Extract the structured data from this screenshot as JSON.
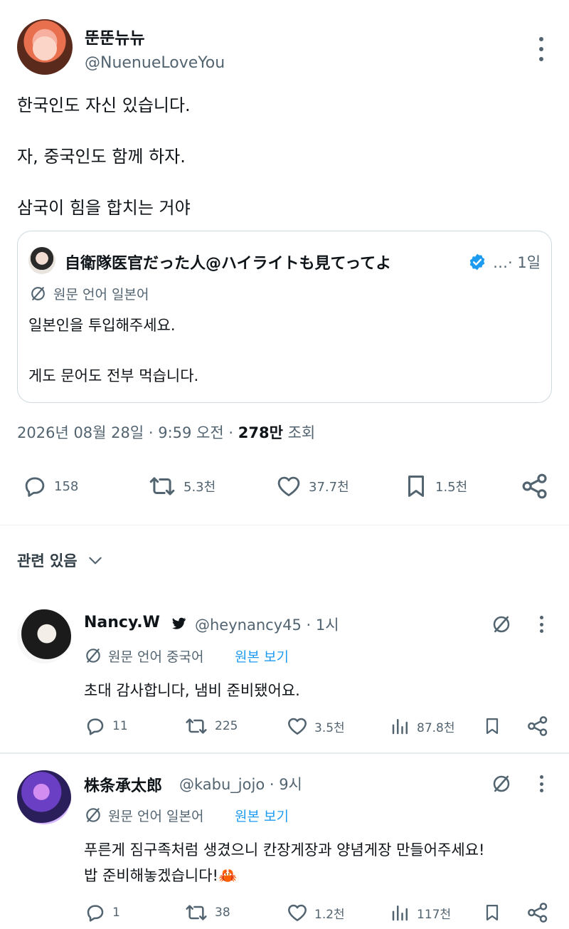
{
  "main_tweet": {
    "author_name": "뚠뚠뉴뉴",
    "handle": "@NuenueLoveYou",
    "lines": [
      "한국인도 자신 있습니다.",
      "자, 중국인도 함께 하자.",
      "삼국이 힘을 합치는 거야"
    ],
    "quote": {
      "author_name": "自衛隊医官だった人@ハイライトも見てってよ",
      "ellipsis": "…",
      "time": "· 1일",
      "lang_label": "원문 언어 일본어",
      "lines": [
        "일본인을 투입해주세요.",
        "게도 문어도 전부 먹습니다."
      ]
    },
    "meta": {
      "datetime": "2026년 08월 28일 · 9:59 오전 ·",
      "views_count": "278만",
      "views_label": "조회"
    },
    "actions": {
      "replies": "158",
      "retweets": "5.3천",
      "likes": "37.7천",
      "bookmarks": "1.5천"
    }
  },
  "related": {
    "label": "관련 있음"
  },
  "replies": [
    {
      "author_name": "Nancy.W",
      "handle": "@heynancy45 · 1시",
      "lang_label": "원문 언어 중국어",
      "show_original": "원본 보기",
      "lines": [
        "초대 감사합니다, 냄비 준비됐어요."
      ],
      "actions": {
        "replies": "11",
        "retweets": "225",
        "likes": "3.5천",
        "views": "87.8천"
      }
    },
    {
      "author_name": "株条承太郎",
      "handle": "@kabu_jojo · 9시",
      "lang_label": "원문 언어 일본어",
      "show_original": "원본 보기",
      "lines": [
        "푸른게 짐구족처럼 생겼으니 칸장게장과 양념게장 만들어주세요!",
        "밥 준비해놓겠습니다!"
      ],
      "emoji": "🦀",
      "actions": {
        "replies": "1",
        "retweets": "38",
        "likes": "1.2천",
        "views": "117천"
      }
    }
  ],
  "colors": {
    "text": "#0f1419",
    "muted": "#536471",
    "accent": "#1d9bf0",
    "border": "#cfd9de"
  },
  "icons": [
    "more-icon",
    "verified-badge-icon",
    "translate-icon",
    "reply-icon",
    "retweet-icon",
    "like-icon",
    "bookmark-icon",
    "share-icon",
    "views-icon",
    "chevron-down-icon",
    "twitter-bird-icon",
    "crab-emoji"
  ]
}
